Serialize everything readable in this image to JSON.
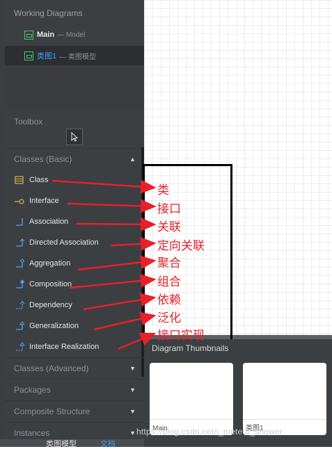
{
  "working_diagrams": {
    "header": "Working Diagrams",
    "items": [
      {
        "name": "Main",
        "sub": "— Model",
        "active": false
      },
      {
        "name": "类图1",
        "sub": "— 类图模型",
        "active": true
      }
    ]
  },
  "toolbox": {
    "header": "Toolbox",
    "cursor_icon": "pointer-icon"
  },
  "categories": {
    "basic": "Classes (Basic)",
    "advanced": "Classes (Advanced)",
    "packages": "Packages",
    "composite": "Composite Structure",
    "instances": "Instances"
  },
  "tools": [
    {
      "label": "Class",
      "icon": "class-icon"
    },
    {
      "label": "Interface",
      "icon": "interface-icon"
    },
    {
      "label": "Association",
      "icon": "association-icon"
    },
    {
      "label": "Directed Association",
      "icon": "directed-association-icon"
    },
    {
      "label": "Aggregation",
      "icon": "aggregation-icon"
    },
    {
      "label": "Composition",
      "icon": "composition-icon"
    },
    {
      "label": "Dependency",
      "icon": "dependency-icon"
    },
    {
      "label": "Generalization",
      "icon": "generalization-icon"
    },
    {
      "label": "Interface Realization",
      "icon": "interface-realization-icon"
    }
  ],
  "annotations": [
    "类",
    "接口",
    "关联",
    "定向关联",
    "聚合",
    "组合",
    "依赖",
    "泛化",
    "接口实现"
  ],
  "thumbnails": {
    "header": "Diagram Thumbnails",
    "items": [
      "Main",
      "类图1"
    ]
  },
  "bottom_tabs": [
    "类图模型",
    "文档"
  ],
  "watermark": "https://blog.csdn.net/i_meteor_shower",
  "colors": {
    "panel": "#3c3f42",
    "annotation_red": "#e8202a",
    "diagram_green": "#3ec96b",
    "active_link": "#3aa0ff",
    "tool_icon_yellow": "#d7b54a",
    "tool_icon_blue": "#4aa3f0"
  }
}
